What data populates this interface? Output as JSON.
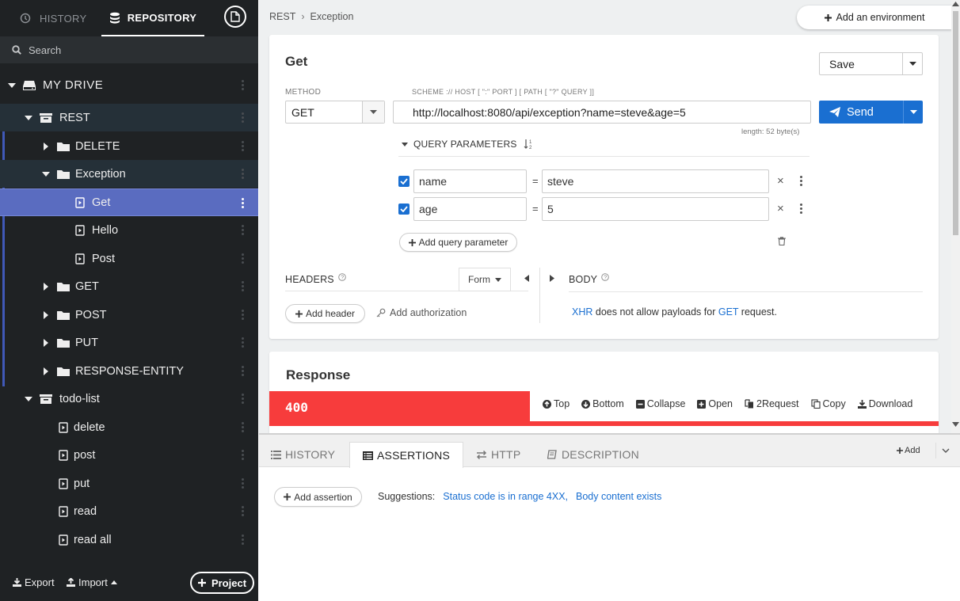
{
  "sidebar": {
    "tabs": {
      "history": "HISTORY",
      "repository": "REPOSITORY"
    },
    "search_placeholder": "Search",
    "tree": {
      "mydrive": "MY DRIVE",
      "rest": "REST",
      "delete": "DELETE",
      "exception": "Exception",
      "get_req": "Get",
      "hello": "Hello",
      "post_req": "Post",
      "get_folder": "GET",
      "post_folder": "POST",
      "put_folder": "PUT",
      "response_entity": "RESPONSE-ENTITY",
      "todo_list": "todo-list",
      "todo_delete": "delete",
      "todo_post": "post",
      "todo_put": "put",
      "todo_read": "read",
      "todo_readall": "read all"
    },
    "footer": {
      "export": "Export",
      "import": "Import",
      "project": "Project"
    }
  },
  "main": {
    "breadcrumb": [
      "REST",
      "Exception"
    ],
    "add_env": "Add an environment",
    "request": {
      "title": "Get",
      "save": "Save",
      "method_caption": "METHOD",
      "url_caption": "SCHEME :// HOST [ \":\" PORT ] [ PATH [ \"?\" QUERY ]]",
      "method": "GET",
      "url": "http://localhost:8080/api/exception?name=steve&age=5",
      "length": "length: 52 byte(s)",
      "send": "Send",
      "query_header": "QUERY PARAMETERS",
      "params": [
        {
          "name": "name",
          "value": "steve"
        },
        {
          "name": "age",
          "value": "5"
        }
      ],
      "add_param": "Add query parameter",
      "headers_label": "HEADERS",
      "form": "Form",
      "body_label": "BODY",
      "add_header": "Add header",
      "add_auth": "Add authorization",
      "xhr_pre": "XHR",
      "xhr_mid": " does not allow payloads for ",
      "xhr_get": "GET",
      "xhr_post": " request."
    },
    "response": {
      "title": "Response",
      "status": "400",
      "toolbar": [
        "Top",
        "Bottom",
        "Collapse",
        "Open",
        "2Request",
        "Copy",
        "Download"
      ]
    }
  },
  "bottom": {
    "tabs": {
      "history": "HISTORY",
      "assertions": "ASSERTIONS",
      "http": "HTTP",
      "description": "DESCRIPTION"
    },
    "add": "Add",
    "add_assertion": "Add assertion",
    "suggestions_label": "Suggestions:",
    "suggestions": [
      "Status code is in range 4XX,",
      "Body content exists"
    ]
  },
  "colors": {
    "accent": "#1a6fd1",
    "error": "#f73c3c",
    "sidebar_bg": "#1f2224",
    "selected_row": "#5a6cc0"
  }
}
